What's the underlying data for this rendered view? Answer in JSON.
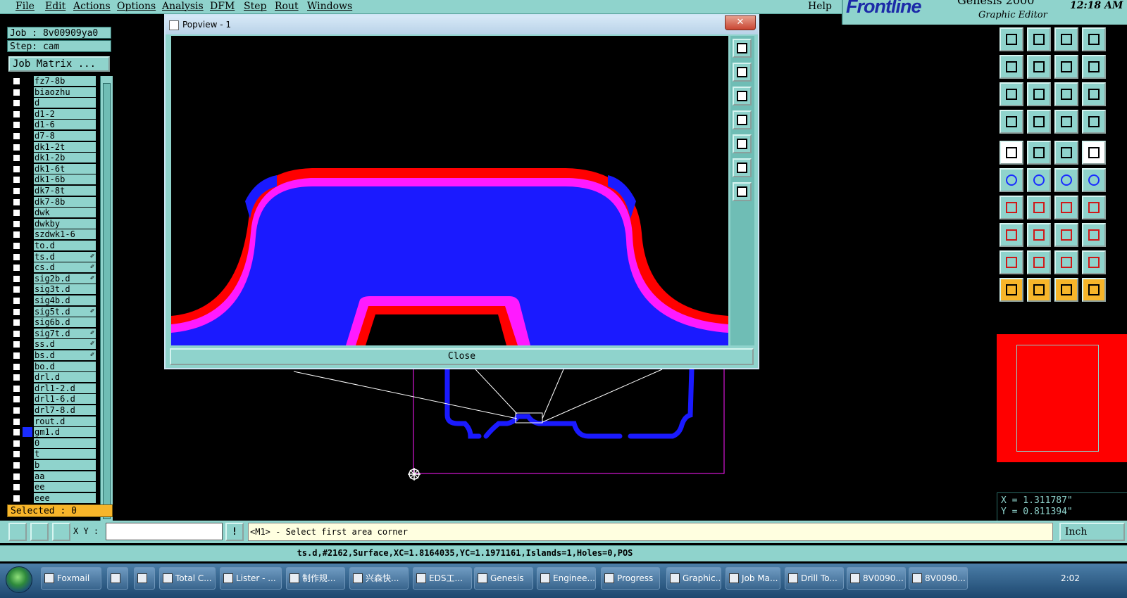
{
  "menu": {
    "items": [
      "File",
      "Edit",
      "Actions",
      "Options",
      "Analysis",
      "DFM",
      "Step",
      "Rout",
      "Windows"
    ],
    "help": "Help"
  },
  "brand": {
    "logo": "Frontline",
    "product": "Genesis 2000",
    "subtitle": "Graphic Editor",
    "time": "12:18 AM"
  },
  "left_panel": {
    "job": "Job : 8v00909ya0",
    "step": "Step: cam",
    "job_matrix": "Job Matrix ...",
    "layers": [
      {
        "name": "fz7-8b",
        "flag": "",
        "color": "#000000"
      },
      {
        "name": "biaozhu",
        "flag": "",
        "color": "#000000"
      },
      {
        "name": "d",
        "flag": "",
        "color": "#000000"
      },
      {
        "name": "d1-2",
        "flag": "",
        "color": "#000000"
      },
      {
        "name": "d1-6",
        "flag": "",
        "color": "#000000"
      },
      {
        "name": "d7-8",
        "flag": "",
        "color": "#000000"
      },
      {
        "name": "dk1-2t",
        "flag": "",
        "color": "#000000"
      },
      {
        "name": "dk1-2b",
        "flag": "",
        "color": "#000000"
      },
      {
        "name": "dk1-6t",
        "flag": "",
        "color": "#000000"
      },
      {
        "name": "dk1-6b",
        "flag": "",
        "color": "#000000"
      },
      {
        "name": "dk7-8t",
        "flag": "",
        "color": "#000000"
      },
      {
        "name": "dk7-8b",
        "flag": "",
        "color": "#000000"
      },
      {
        "name": "dwk",
        "flag": "",
        "color": "#000000"
      },
      {
        "name": "dwkby",
        "flag": "",
        "color": "#000000"
      },
      {
        "name": "szdwk1-6",
        "flag": "",
        "color": "#000000"
      },
      {
        "name": "to.d",
        "flag": "",
        "color": "#000000"
      },
      {
        "name": "ts.d",
        "flag": "✐",
        "color": "#000000"
      },
      {
        "name": "cs.d",
        "flag": "✐",
        "color": "#000000"
      },
      {
        "name": "sig2b.d",
        "flag": "✐",
        "color": "#000000"
      },
      {
        "name": "sig3t.d",
        "flag": "",
        "color": "#000000"
      },
      {
        "name": "sig4b.d",
        "flag": "",
        "color": "#000000"
      },
      {
        "name": "sig5t.d",
        "flag": "✐",
        "color": "#000000"
      },
      {
        "name": "sig6b.d",
        "flag": "",
        "color": "#000000"
      },
      {
        "name": "sig7t.d",
        "flag": "✐",
        "color": "#000000"
      },
      {
        "name": "ss.d",
        "flag": "✐",
        "color": "#000000"
      },
      {
        "name": "bs.d",
        "flag": "✐",
        "color": "#000000"
      },
      {
        "name": "bo.d",
        "flag": "",
        "color": "#000000"
      },
      {
        "name": "drl.d",
        "flag": "",
        "color": "#000000"
      },
      {
        "name": "drl1-2.d",
        "flag": "",
        "color": "#000000"
      },
      {
        "name": "drl1-6.d",
        "flag": "",
        "color": "#000000"
      },
      {
        "name": "drl7-8.d",
        "flag": "",
        "color": "#000000"
      },
      {
        "name": "rout.d",
        "flag": "",
        "color": "#000000"
      },
      {
        "name": "gm1.d",
        "flag": "",
        "color": "#1a2cff"
      },
      {
        "name": "0",
        "flag": "",
        "color": "#000000"
      },
      {
        "name": "t",
        "flag": "",
        "color": "#000000"
      },
      {
        "name": "b",
        "flag": "",
        "color": "#000000"
      },
      {
        "name": "aa",
        "flag": "",
        "color": "#000000"
      },
      {
        "name": "ee",
        "flag": "",
        "color": "#000000"
      },
      {
        "name": "eee",
        "flag": "",
        "color": "#000000"
      }
    ],
    "selected": "Selected : 0"
  },
  "popview": {
    "title": "Popview - 1",
    "close_x": "✕",
    "close_button": "Close",
    "colors": {
      "surface": "#1a1aff",
      "red": "#ff0000",
      "magenta": "#ff1aff"
    }
  },
  "toolbox": {
    "icons": [
      "move-up-icon",
      "move-down-icon",
      "home-icon",
      "zoom-extents-icon",
      "move-left-icon",
      "move-right-icon",
      "undo-view-icon",
      "redo-view-icon",
      "fit-icon",
      "center-icon",
      "scale-1to2-icon",
      "help-icon",
      "palette-icon",
      "probe-icon",
      "layers-icon",
      "layers-icon",
      "pad-icon",
      "clip-icon",
      "ruler-icon",
      "dot-icon",
      "net-icon",
      "cross-icon",
      "line-node-icon",
      "line-node-icon",
      "angle-line-icon",
      "diag-line-icon",
      "arc-icon",
      "filter-icon",
      "move-pad-icon",
      "line-icon",
      "measure-icon",
      "group-icon",
      "triangle-icon",
      "triangle-up-icon",
      "triangle-text-icon",
      "triangle-cursor-icon",
      "cursor-icon",
      "cursor-select-icon",
      "cursor-edit-icon",
      "cursor-net-icon"
    ]
  },
  "coords": {
    "x": "X = 1.311787\"",
    "y": "Y = 0.811394\""
  },
  "prompt": {
    "xy_label": "X Y :",
    "xy_value": "",
    "bang": "!",
    "message": "<M1> - Select first area corner",
    "units": "Inch"
  },
  "status": {
    "text": "ts.d,#2162,Surface,XC=1.8164035,YC=1.1971161,Islands=1,Holes=0,POS"
  },
  "taskbar": {
    "tasks": [
      "Foxmail",
      "",
      "",
      "Total C...",
      "Lister - ...",
      "制作规...",
      "兴森快...",
      "EDS工...",
      "Genesis",
      "Enginee...",
      "Progress",
      "Graphic...",
      "Job Ma...",
      "Drill To...",
      "8V0090...",
      "8V0090..."
    ],
    "time": "2:02"
  }
}
